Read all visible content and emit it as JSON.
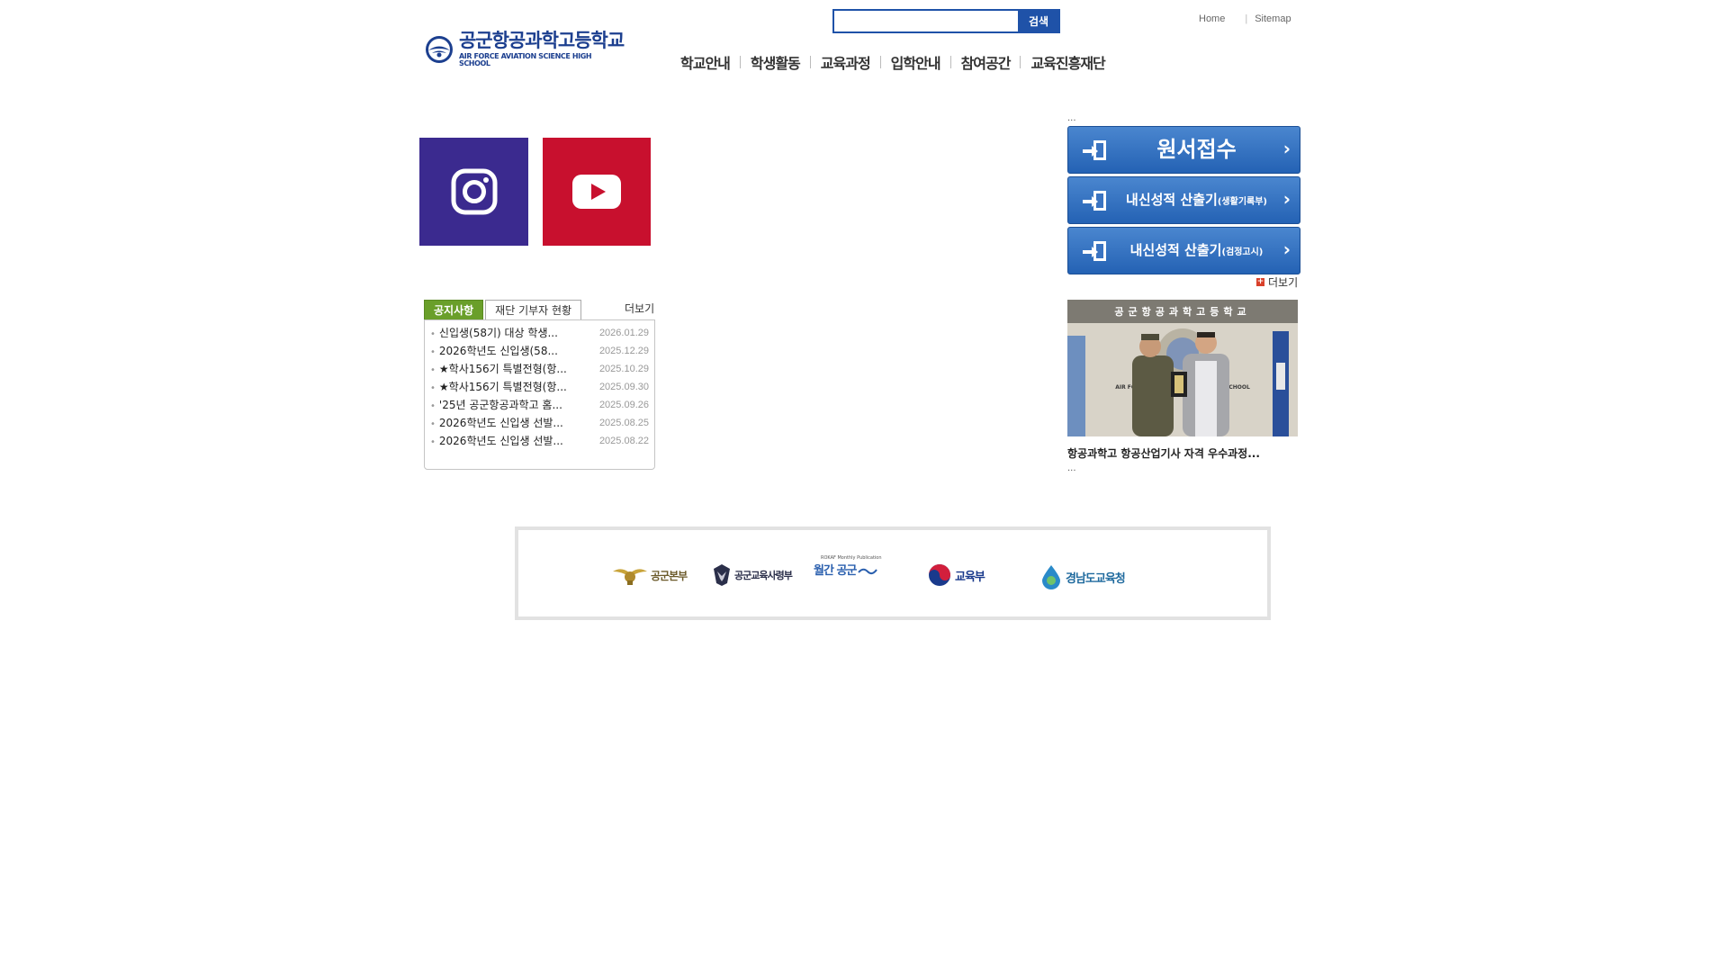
{
  "header": {
    "logo": {
      "title_ko": "공군항공과학고등학교",
      "title_en": "AIR FORCE AVIATION SCIENCE HIGH SCHOOL"
    },
    "search": {
      "value": "",
      "placeholder": "",
      "button_label": "검색"
    },
    "top_links": {
      "home": "Home",
      "sitemap": "Sitemap"
    },
    "nav": [
      "학교안내",
      "학생활동",
      "교육과정",
      "입학안내",
      "참여공간",
      "교육진흥재단"
    ]
  },
  "social": {
    "instagram": "instagram-icon",
    "youtube": "youtube-icon"
  },
  "notice_board": {
    "tabs": [
      "공지사항",
      "재단 기부자 현황"
    ],
    "active_tab": 0,
    "more_label": "더보기",
    "items": [
      {
        "title": "신입생(58기) 대상 학생...",
        "date": "2026.01.29"
      },
      {
        "title": "2026학년도 신입생(58...",
        "date": "2025.12.29"
      },
      {
        "title": "★학사156기 특별전형(항...",
        "date": "2025.10.29"
      },
      {
        "title": "★학사156기 특별전형(항...",
        "date": "2025.09.30"
      },
      {
        "title": "'25년 공군항공과학고 홈...",
        "date": "2025.09.26"
      },
      {
        "title": "2026학년도 신입생 선발...",
        "date": "2025.08.25"
      },
      {
        "title": "2026학년도 신입생 선발...",
        "date": "2025.08.22"
      }
    ]
  },
  "quick_links": {
    "top_dots": "...",
    "apply": "원서접수",
    "grade_record": {
      "main": "내신성적 산출기",
      "sub": "(생활기록부)"
    },
    "grade_ged": {
      "main": "내신성적 산출기",
      "sub": "(검정고시)"
    },
    "more_label": "더보기"
  },
  "news": {
    "title": "항공과학고 항공산업기사 자격 우수과정...",
    "desc": "...",
    "banner_text": "공군항공과학고등학교",
    "flag_text": "AIR FORCE AVIATION SCIENCE HIGH SCHOOL"
  },
  "partners": [
    {
      "name": "공군본부",
      "icon": "air-force-emblem-icon"
    },
    {
      "name": "공군교육사령부",
      "icon": "eagle-emblem-icon"
    },
    {
      "name": "월간 공군",
      "sub": "ROKAF Monthly Publication",
      "icon": "wave-icon"
    },
    {
      "name": "교육부",
      "icon": "taegeuk-icon"
    },
    {
      "name": "경남도교육청",
      "icon": "drop-icon"
    }
  ],
  "colors": {
    "brand_blue": "#1c3f8f",
    "quick_blue": "#2462b4",
    "notice_green": "#6a9f2a",
    "instagram_purple": "#3b2a8f",
    "youtube_red": "#c8102e"
  }
}
